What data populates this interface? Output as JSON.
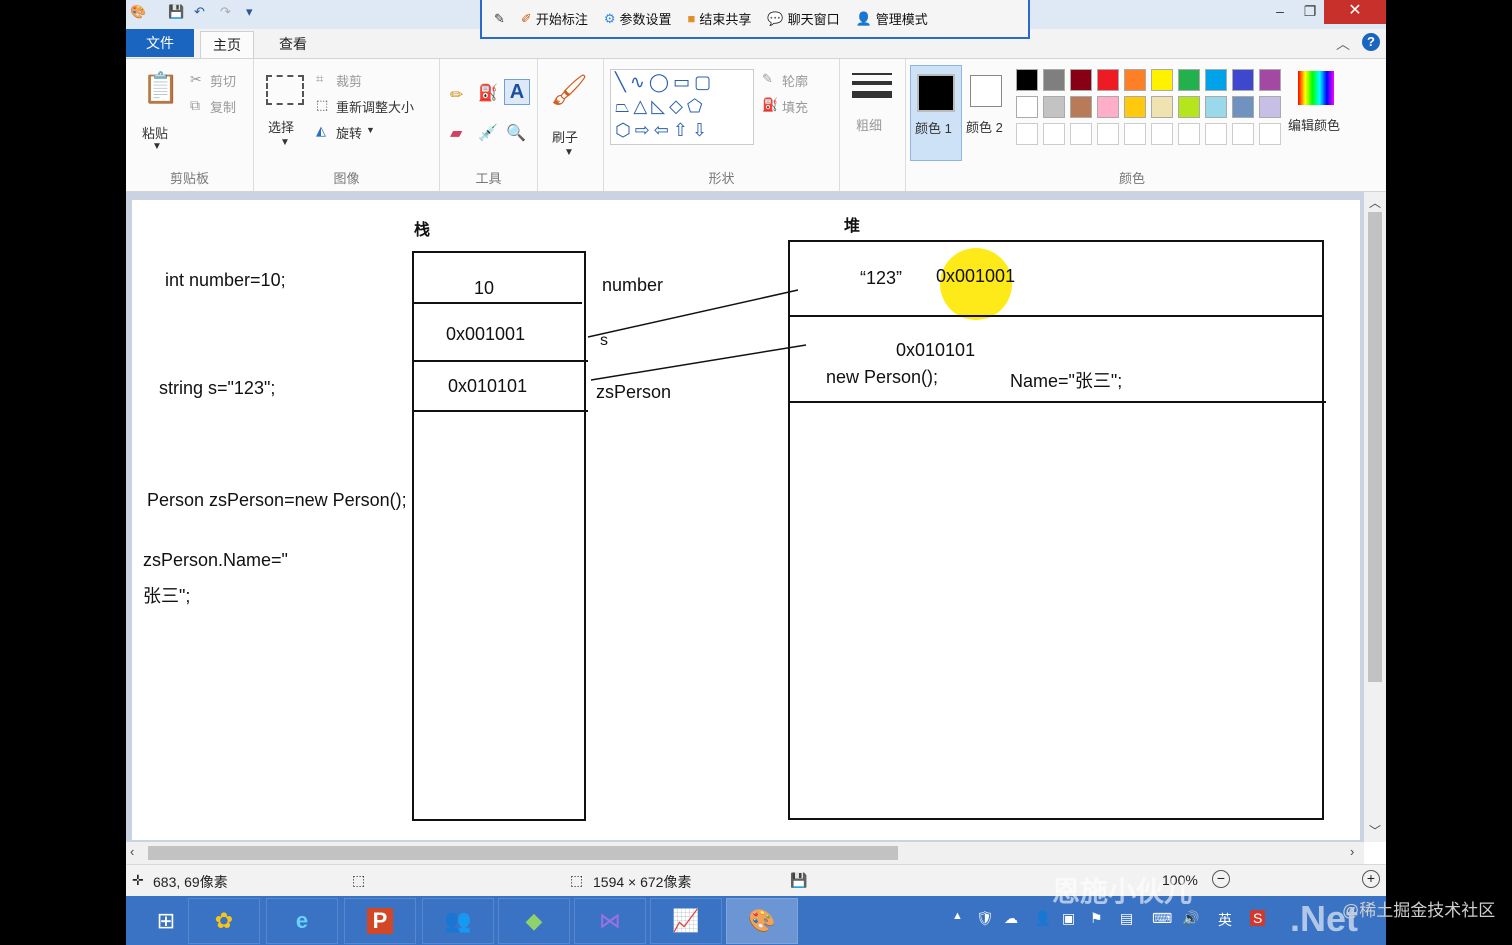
{
  "share_toolbar": {
    "items": [
      {
        "icon": "pin-icon",
        "label": ""
      },
      {
        "icon": "pen-icon",
        "label": "开始标注"
      },
      {
        "icon": "settings-icon",
        "label": "参数设置"
      },
      {
        "icon": "stop-share-icon",
        "label": "结束共享"
      },
      {
        "icon": "chat-icon",
        "label": "聊天窗口"
      },
      {
        "icon": "admin-icon",
        "label": "管理模式"
      }
    ]
  },
  "window": {
    "close": "✕",
    "minimize": "–",
    "maximize": "❐"
  },
  "tabs": {
    "file": "文件",
    "home": "主页",
    "view": "查看"
  },
  "ribbon": {
    "clipboard": {
      "paste": "粘贴",
      "cut": "剪切",
      "copy": "复制",
      "label": "剪贴板"
    },
    "image": {
      "select": "选择",
      "crop": "裁剪",
      "resize": "重新调整大小",
      "rotate": "旋转",
      "label": "图像"
    },
    "tools": {
      "label": "工具"
    },
    "brushes": {
      "label": "刷子"
    },
    "shapes": {
      "outline": "轮廓",
      "fill": "填充",
      "label": "形状"
    },
    "size": {
      "label": "粗细"
    },
    "colors": {
      "color1": "颜色 1",
      "color2": "颜色 2",
      "edit": "编辑颜色",
      "label": "颜色",
      "palette_row1": [
        "#000000",
        "#7f7f7f",
        "#880015",
        "#ed1c24",
        "#ff7f27",
        "#fff200",
        "#22b14c",
        "#00a2e8",
        "#3f48cc",
        "#a349a4"
      ],
      "palette_row2": [
        "#ffffff",
        "#c3c3c3",
        "#b97a57",
        "#ffaec9",
        "#ffc90e",
        "#efe4b0",
        "#b5e61d",
        "#99d9ea",
        "#7092be",
        "#c8bfe7"
      ]
    }
  },
  "canvas": {
    "stack_title": "栈",
    "heap_title": "堆",
    "code_int": "int number=10;",
    "code_string": "string s=\"123\";",
    "code_person": "Person zsPerson=new Person();",
    "code_name_1": "zsPerson.Name=\"",
    "code_name_2": "张三\";",
    "stack_cells": [
      "10",
      "0x001001",
      "0x010101"
    ],
    "var_number": "number",
    "var_s": "s",
    "var_zsperson": "zsPerson",
    "heap_str_value": "“123”",
    "heap_str_addr": "0x001001",
    "heap_obj_addr": "0x010101",
    "heap_obj_new": "new Person();",
    "heap_obj_name": "Name=\"张三\";"
  },
  "status": {
    "cursor_pos": "683, 69像素",
    "image_size": "1594 × 672像素",
    "zoom": "100%"
  },
  "taskbar": {
    "apps": [
      "windows-start-icon",
      "app-store-icon",
      "internet-explorer-icon",
      "powerpoint-icon",
      "users-icon",
      "cube-icon",
      "visual-studio-icon",
      "chart-app-icon",
      "paint-icon"
    ],
    "tray_lang": "英"
  },
  "watermarks": {
    "overlay": "恩施小伙儿",
    "net": ".Net",
    "community": "@稀土掘金技术社区"
  }
}
